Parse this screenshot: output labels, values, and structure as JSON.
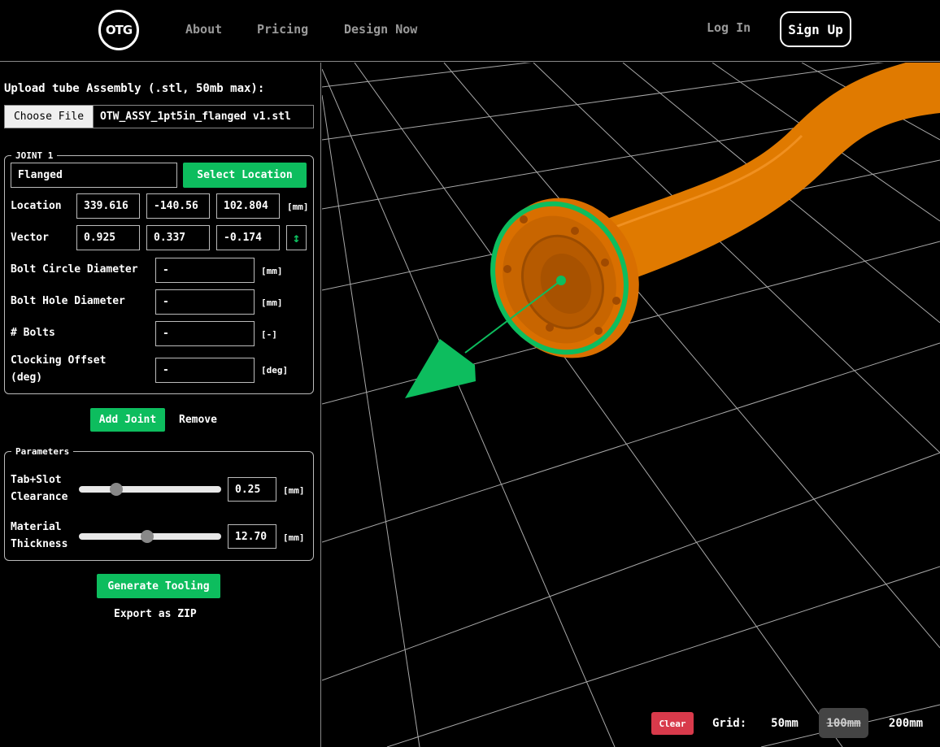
{
  "header": {
    "logo_text": "OTG",
    "nav": [
      "About",
      "Pricing",
      "Design Now"
    ],
    "login_label": "Log In",
    "signup_label": "Sign Up"
  },
  "upload": {
    "label": "Upload tube Assembly (.stl, 50mb max):",
    "choose_label": "Choose File",
    "file_name": "OTW_ASSY_1pt5in_flanged v1.stl"
  },
  "joint": {
    "legend": "JOINT 1",
    "type_value": "Flanged",
    "select_location_label": "Select Location",
    "location_label": "Location",
    "location_values": [
      "339.616",
      "-140.56",
      "102.804"
    ],
    "location_unit": "[mm]",
    "vector_label": "Vector",
    "vector_values": [
      "0.925",
      "0.337",
      "-0.174"
    ],
    "flip_icon": "up-down-arrow-icon",
    "bolt_circle_label": "Bolt Circle Diameter",
    "bolt_circle_value": "-",
    "bolt_circle_unit": "[mm]",
    "bolt_hole_label": "Bolt Hole Diameter",
    "bolt_hole_value": "-",
    "bolt_hole_unit": "[mm]",
    "bolts_label": "# Bolts",
    "bolts_value": "-",
    "bolts_unit": "[-]",
    "clocking_label_1": "Clocking Offset",
    "clocking_label_2": "(deg)",
    "clocking_value": "-",
    "clocking_unit": "[deg]"
  },
  "joint_actions": {
    "add_label": "Add Joint",
    "remove_label": "Remove"
  },
  "parameters": {
    "legend": "Parameters",
    "clearance_label_1": "Tab+Slot",
    "clearance_label_2": "Clearance",
    "clearance_value": "0.25",
    "clearance_unit": "[mm]",
    "clearance_slider_fraction": 0.24,
    "thickness_label_1": "Material",
    "thickness_label_2": "Thickness",
    "thickness_value": "12.70",
    "thickness_unit": "[mm]",
    "thickness_slider_fraction": 0.48
  },
  "actions": {
    "generate_label": "Generate Tooling",
    "export_label": "Export as ZIP"
  },
  "viewport": {
    "clear_label": "Clear",
    "grid_label": "Grid:",
    "grid_options": [
      "50mm",
      "100mm",
      "200mm"
    ],
    "grid_selected": "100mm",
    "tube_color": "#e07a00",
    "accent_color": "#0dbd5e"
  }
}
